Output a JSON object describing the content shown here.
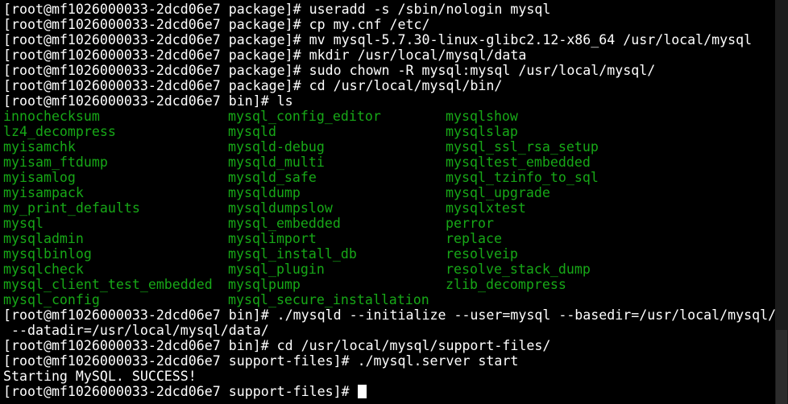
{
  "terminal": {
    "prompt_package": "[root@mf1026000033-2dcd06e7 package]# ",
    "prompt_bin": "[root@mf1026000033-2dcd06e7 bin]# ",
    "prompt_support": "[root@mf1026000033-2dcd06e7 support-files]# ",
    "lines": [
      "[root@mf1026000033-2dcd06e7 package]# useradd -s /sbin/nologin mysql",
      "[root@mf1026000033-2dcd06e7 package]# cp my.cnf /etc/",
      "[root@mf1026000033-2dcd06e7 package]# mv mysql-5.7.30-linux-glibc2.12-x86_64 /usr/local/mysql",
      "[root@mf1026000033-2dcd06e7 package]# mkdir /usr/local/mysql/data",
      "[root@mf1026000033-2dcd06e7 package]# sudo chown -R mysql:mysql /usr/local/mysql/",
      "[root@mf1026000033-2dcd06e7 package]# cd /usr/local/mysql/bin/",
      "[root@mf1026000033-2dcd06e7 bin]# ls"
    ],
    "ls_rows": [
      [
        "innochecksum",
        "mysql_config_editor",
        "mysqlshow"
      ],
      [
        "lz4_decompress",
        "mysqld",
        "mysqlslap"
      ],
      [
        "myisamchk",
        "mysqld-debug",
        "mysql_ssl_rsa_setup"
      ],
      [
        "myisam_ftdump",
        "mysqld_multi",
        "mysqltest_embedded"
      ],
      [
        "myisamlog",
        "mysqld_safe",
        "mysql_tzinfo_to_sql"
      ],
      [
        "myisampack",
        "mysqldump",
        "mysql_upgrade"
      ],
      [
        "my_print_defaults",
        "mysqldumpslow",
        "mysqlxtest"
      ],
      [
        "mysql",
        "mysql_embedded",
        "perror"
      ],
      [
        "mysqladmin",
        "mysqlimport",
        "replace"
      ],
      [
        "mysqlbinlog",
        "mysql_install_db",
        "resolveip"
      ],
      [
        "mysqlcheck",
        "mysql_plugin",
        "resolve_stack_dump"
      ],
      [
        "mysql_client_test_embedded",
        "mysqlpump",
        "zlib_decompress"
      ],
      [
        "mysql_config",
        "mysql_secure_installation",
        ""
      ]
    ],
    "after_lines": [
      "[root@mf1026000033-2dcd06e7 bin]# ./mysqld --initialize --user=mysql --basedir=/usr/local/mysql/",
      "--datadir=/usr/local/mysql/data/",
      "[root@mf1026000033-2dcd06e7 bin]# cd /usr/local/mysql/support-files/",
      "[root@mf1026000033-2dcd06e7 support-files]# ./mysql.server start",
      "Starting MySQL. SUCCESS!"
    ],
    "final_prompt": "[root@mf1026000033-2dcd06e7 support-files]# ",
    "colors": {
      "background": "#000000",
      "text": "#ffffff",
      "executable": "#17a817"
    }
  }
}
